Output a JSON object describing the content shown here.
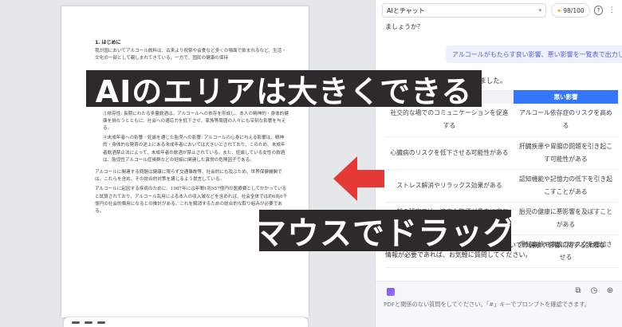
{
  "document": {
    "heading": "1. はじめに",
    "paragraphs": [
      "我が国においてアルコール飲料は、古来より祝祭や会食など多くの場面で飲まれるなど、生活・文化の一部として親しまれてきている。一方で、国民の健康の保持",
      "関連する。",
      "②依存性: 長期にわたる多量飲酒は、アルコールへの依存を形成し、本人の精神的・身体的健康を損なうとともに、社会への適応力を低下させ、家族等周囲の人々にも深刻な影響を与える。",
      "④未成年者への影響・妊娠を通じた胎児への影響: アルコールの心身に与える影響は、精神的・身体的な発育の途上にある未成年者においては大きいとされており、このため、未成年者飲酒禁止法によって、未成年者の飲酒が禁止されている。また、妊娠している女性の飲酒は、胎児性アルコール症候群などの妊娠に関連した異常の危険因子である。",
      "アルコールに関連する問題は健康に限らず交通事故等、社会的にも及ぶため、世界保健機関では、これらを含め、その総合的対策を講じるよう提言している。",
      "アルコールに起因する疾病のために、1987年には年間1兆957億円の医療費としてかかっていると試算されており、アルコール乱用による本人の収入減などを含めれば、社会全体では約6兆6千億円の社会的費用になるとの推計がある。これを解消するための総合的な取り組みが必要である。"
    ]
  },
  "chat": {
    "model_label": "AIとチャット",
    "credits": "98/100",
    "ai_message_top": "ましょうか？",
    "user_message": "アルコールがもたらす良い影響、悪い影響を一覧表で出力して",
    "ai_intro": "響を以下に一覧表としてまとめました。",
    "table": {
      "headers": [
        "",
        "悪い影響"
      ],
      "rows": [
        [
          "社交的な場でのコミュニケーションを促進する",
          "アルコール依存症のリスクを高める"
        ],
        [
          "心臓病のリスクを低下させる可能性がある",
          "肝臓疾患や胃腸の問題を引き起こす可能性がある"
        ],
        [
          "ストレス解消やリラックス効果がある",
          "認知機能や記憶力の低下を引き起こすことがある"
        ],
        [
          "一部の研究では、適度な飲酒が長寿に寄与する可能性がある",
          "胎児の健康に悪影響を及ぼすことがある"
        ],
        [
          "",
          "運転事故や事故のリスクを増加させる"
        ]
      ]
    },
    "ai_outro": "情報が必要であれば、お気軽に質問してください。",
    "ai_outro_partial": "についての健康や影響に関する詳細な",
    "input_placeholder": "PDFと関係のない質問をしてください。「#」キーでプロンプトを確認できます。"
  },
  "captions": {
    "top": "AIのエリアは大きくできる",
    "bottom": "マウスでドラッグ"
  },
  "colors": {
    "accent_blue": "#3377ff",
    "arrow_red": "#e53935",
    "caption_bg": "#2e2a2b"
  }
}
